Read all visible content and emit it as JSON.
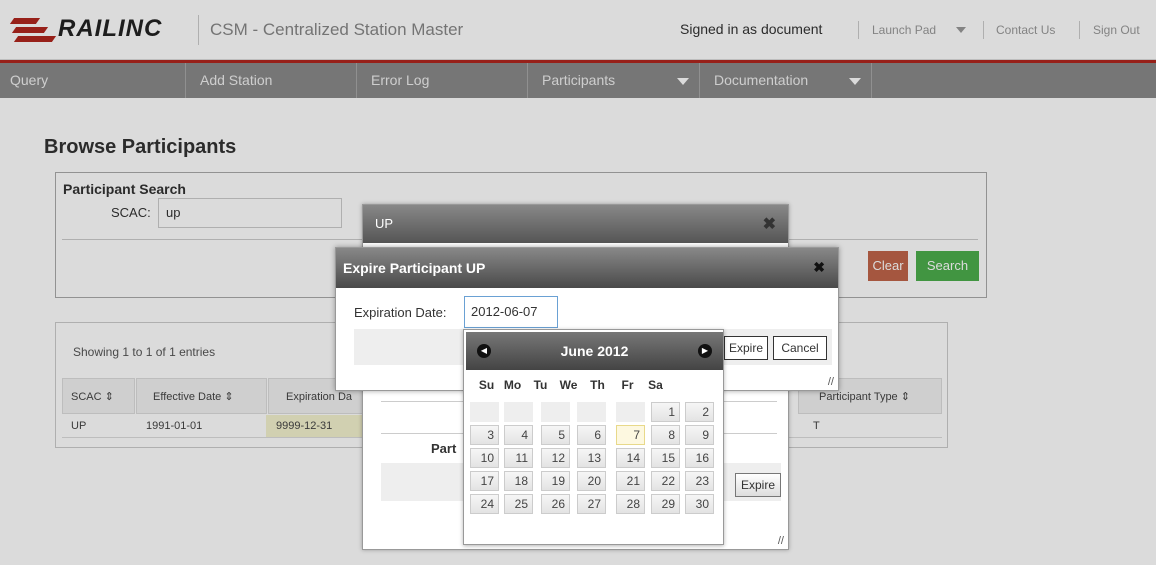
{
  "header": {
    "logo_text": "RAILINC",
    "app_title": "CSM - Centralized Station Master",
    "signed_in": "Signed in as document",
    "links": [
      "Launch Pad",
      "Contact Us",
      "Sign Out"
    ]
  },
  "nav": {
    "items": [
      "Query",
      "Add Station",
      "Error Log",
      "Participants",
      "Documentation"
    ]
  },
  "page": {
    "title": "Browse Participants"
  },
  "search": {
    "title": "Participant Search",
    "scac_label": "SCAC:",
    "scac_value": "up",
    "clear_label": "Clear",
    "search_label": "Search"
  },
  "table": {
    "showing": "Showing 1 to 1 of 1 entries",
    "headers": [
      "SCAC",
      "Effective Date",
      "Expiration Da",
      "Participant Type"
    ],
    "row": [
      "UP",
      "1991-01-01",
      "9999-12-31",
      "T"
    ]
  },
  "up_dialog": {
    "title": "UP",
    "participant_label": "Part",
    "expire_label": "Expire"
  },
  "expire_dialog": {
    "title": "Expire Participant UP",
    "date_label": "Expiration Date:",
    "date_value": "2012-06-07",
    "expire_label": "Expire",
    "cancel_label": "Cancel"
  },
  "datepicker": {
    "month_title": "June 2012",
    "days_of_week": [
      "Su",
      "Mo",
      "Tu",
      "We",
      "Th",
      "Fr",
      "Sa"
    ],
    "weeks": [
      [
        "",
        "",
        "",
        "",
        "",
        "1",
        "2"
      ],
      [
        "3",
        "4",
        "5",
        "6",
        "7",
        "8",
        "9"
      ],
      [
        "10",
        "11",
        "12",
        "13",
        "14",
        "15",
        "16"
      ],
      [
        "17",
        "18",
        "19",
        "20",
        "21",
        "22",
        "23"
      ],
      [
        "24",
        "25",
        "26",
        "27",
        "28",
        "29",
        "30"
      ]
    ],
    "selected_day": "7"
  },
  "colors": {
    "brand_red": "#b0261e",
    "nav_gray": "#8a8a8a",
    "clear_button": "#c0654a",
    "search_button": "#4cae4c"
  }
}
